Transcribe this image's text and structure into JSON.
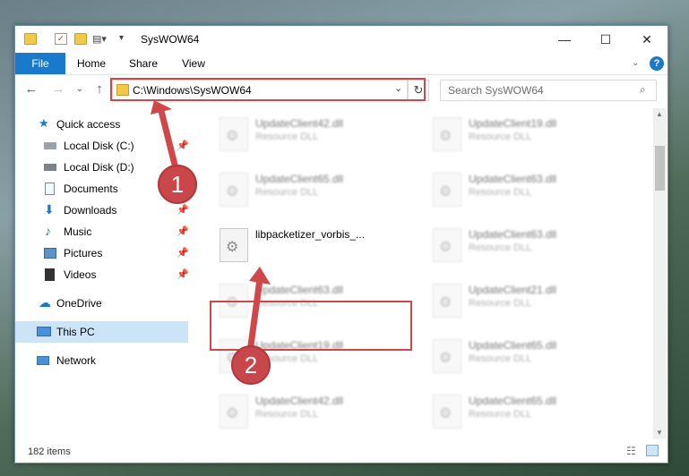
{
  "window": {
    "title": "SysWOW64"
  },
  "ribbon": {
    "tabs": [
      "File",
      "Home",
      "Share",
      "View"
    ]
  },
  "nav": {
    "address": "C:\\Windows\\SysWOW64",
    "search_placeholder": "Search SysWOW64"
  },
  "sidebar": {
    "items": [
      {
        "label": "Quick access"
      },
      {
        "label": "Local Disk (C:)"
      },
      {
        "label": "Local Disk (D:)"
      },
      {
        "label": "Documents"
      },
      {
        "label": "Downloads"
      },
      {
        "label": "Music"
      },
      {
        "label": "Pictures"
      },
      {
        "label": "Videos"
      },
      {
        "label": "OneDrive"
      },
      {
        "label": "This PC"
      },
      {
        "label": "Network"
      }
    ]
  },
  "files": [
    {
      "name": "UpdateClient42.dll",
      "type": "Resource DLL"
    },
    {
      "name": "UpdateClient19.dll",
      "type": "Resource DLL"
    },
    {
      "name": "UpdateClient65.dll",
      "type": "Resource DLL"
    },
    {
      "name": "UpdateClient63.dll",
      "type": "Resource DLL"
    },
    {
      "name": "libpacketizer_vorbis_...",
      "type": ""
    },
    {
      "name": "UpdateClient63.dll",
      "type": "Resource DLL"
    },
    {
      "name": "UpdateClient63.dll",
      "type": "Resource DLL"
    },
    {
      "name": "UpdateClient21.dll",
      "type": "Resource DLL"
    },
    {
      "name": "UpdateClient19.dll",
      "type": "Resource DLL"
    },
    {
      "name": "UpdateClient65.dll",
      "type": "Resource DLL"
    },
    {
      "name": "UpdateClient42.dll",
      "type": "Resource DLL"
    },
    {
      "name": "UpdateClient65.dll",
      "type": "Resource DLL"
    }
  ],
  "status": {
    "count": "182 items"
  },
  "annotations": {
    "step1": "1",
    "step2": "2"
  }
}
